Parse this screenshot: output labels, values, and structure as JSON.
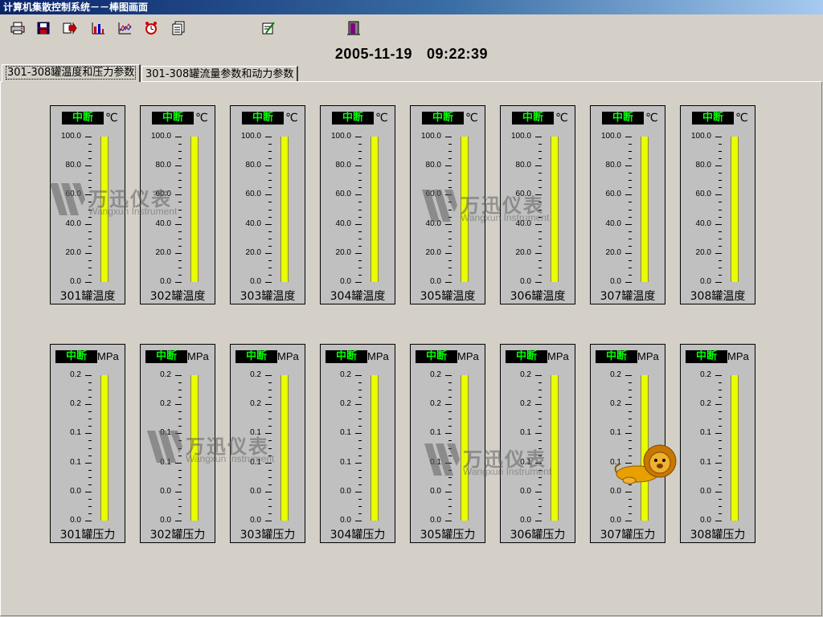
{
  "window": {
    "title": "计算机集散控制系统－－棒图画面"
  },
  "toolbar": {
    "icons": [
      "print-icon",
      "save-icon",
      "export-icon",
      "bar-chart-icon",
      "trend-chart-icon",
      "alarm-clock-icon",
      "report-icon",
      "edit-icon",
      "exit-door-icon"
    ]
  },
  "datetime": {
    "date": "2005-11-19",
    "time": "09:22:39"
  },
  "tabs": [
    {
      "label": "301-308罐温度和压力参数",
      "active": true
    },
    {
      "label": "301-308罐流量参数和动力参数",
      "active": false
    }
  ],
  "temperature": {
    "unit": "℃",
    "ticks": [
      "100.0",
      "80.0",
      "60.0",
      "40.0",
      "20.0",
      "0.0"
    ],
    "gauges": [
      {
        "name": "301罐温度",
        "status": "中断",
        "level": 1.0
      },
      {
        "name": "302罐温度",
        "status": "中断",
        "level": 1.0
      },
      {
        "name": "303罐温度",
        "status": "中断",
        "level": 1.0
      },
      {
        "name": "304罐温度",
        "status": "中断",
        "level": 1.0
      },
      {
        "name": "305罐温度",
        "status": "中断",
        "level": 1.0
      },
      {
        "name": "306罐温度",
        "status": "中断",
        "level": 1.0
      },
      {
        "name": "307罐温度",
        "status": "中断",
        "level": 1.0
      },
      {
        "name": "308罐温度",
        "status": "中断",
        "level": 1.0
      }
    ]
  },
  "pressure": {
    "unit": "MPa",
    "ticks": [
      "0.2",
      "0.2",
      "0.1",
      "0.1",
      "0.0",
      "0.0"
    ],
    "gauges": [
      {
        "name": "301罐压力",
        "status": "中断",
        "level": 1.0
      },
      {
        "name": "302罐压力",
        "status": "中断",
        "level": 1.0
      },
      {
        "name": "303罐压力",
        "status": "中断",
        "level": 1.0
      },
      {
        "name": "304罐压力",
        "status": "中断",
        "level": 1.0
      },
      {
        "name": "305罐压力",
        "status": "中断",
        "level": 1.0
      },
      {
        "name": "306罐压力",
        "status": "中断",
        "level": 1.0
      },
      {
        "name": "307罐压力",
        "status": "中断",
        "level": 1.0
      },
      {
        "name": "308罐压力",
        "status": "中断",
        "level": 1.0
      }
    ]
  },
  "watermark": {
    "cn": "万迅仪表",
    "en": "Wangxun Instrument"
  },
  "colors": {
    "bar": "#e8ff00",
    "status_text": "#00ff00",
    "status_bg": "#000000"
  }
}
